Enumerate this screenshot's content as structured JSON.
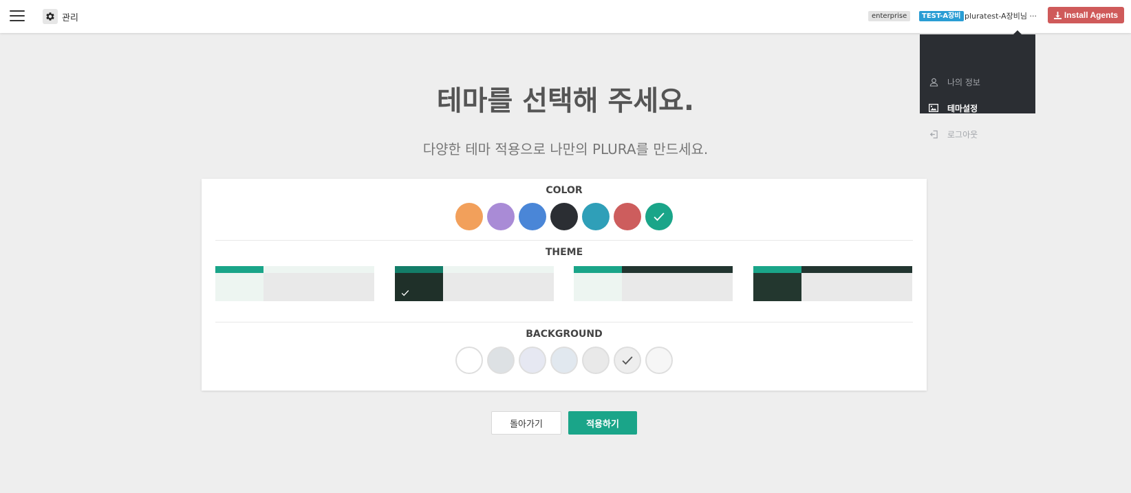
{
  "header": {
    "admin_label": "관리",
    "edition_badge": "enterprise",
    "org_badge": "TEST-A장비",
    "user_name": "pluratest-A장비님 ···",
    "install_button": "Install Agents"
  },
  "user_menu": {
    "items": [
      {
        "label": "나의 정보",
        "icon": "user-icon",
        "active": false
      },
      {
        "label": "테마설정",
        "icon": "image-icon",
        "active": true
      },
      {
        "label": "로그아웃",
        "icon": "logout-icon",
        "active": false
      }
    ]
  },
  "page": {
    "title": "테마를 선택해 주세요.",
    "subtitle": "다양한 테마 적용으로 나만의 PLURA를 만드세요."
  },
  "color_section": {
    "title": "COLOR",
    "swatches": [
      {
        "color": "#f2a05b",
        "selected": false
      },
      {
        "color": "#a98bd6",
        "selected": false
      },
      {
        "color": "#4a86d7",
        "selected": false
      },
      {
        "color": "#2b2e33",
        "selected": false
      },
      {
        "color": "#2f9fb8",
        "selected": false
      },
      {
        "color": "#cd5d5d",
        "selected": false
      },
      {
        "color": "#1aa589",
        "selected": true
      }
    ]
  },
  "theme_section": {
    "title": "THEME",
    "options": [
      {
        "bar_color": "#1aa589",
        "topbar_color": "#edf5f1",
        "sidebar_color": "#edf5f1",
        "selected": false
      },
      {
        "bar_color": "#137d68",
        "topbar_color": "#edf5f1",
        "sidebar_color": "#1f3029",
        "selected": true
      },
      {
        "bar_color": "#1aa589",
        "topbar_color": "#223530",
        "sidebar_color": "#edf5f1",
        "selected": false
      },
      {
        "bar_color": "#1aa589",
        "topbar_color": "#223530",
        "sidebar_color": "#23372f",
        "selected": false
      }
    ]
  },
  "background_section": {
    "title": "BACKGROUND",
    "swatches": [
      {
        "color": "#ffffff",
        "selected": false
      },
      {
        "color": "#dde1e4",
        "selected": false
      },
      {
        "color": "#e6e8f2",
        "selected": false
      },
      {
        "color": "#e1e8ef",
        "selected": false
      },
      {
        "color": "#e9e9e9",
        "selected": false
      },
      {
        "color": "#eeeeee",
        "selected": true
      },
      {
        "color": "#f6f6f6",
        "selected": false
      }
    ]
  },
  "actions": {
    "back_label": "돌아가기",
    "apply_label": "적용하기"
  }
}
